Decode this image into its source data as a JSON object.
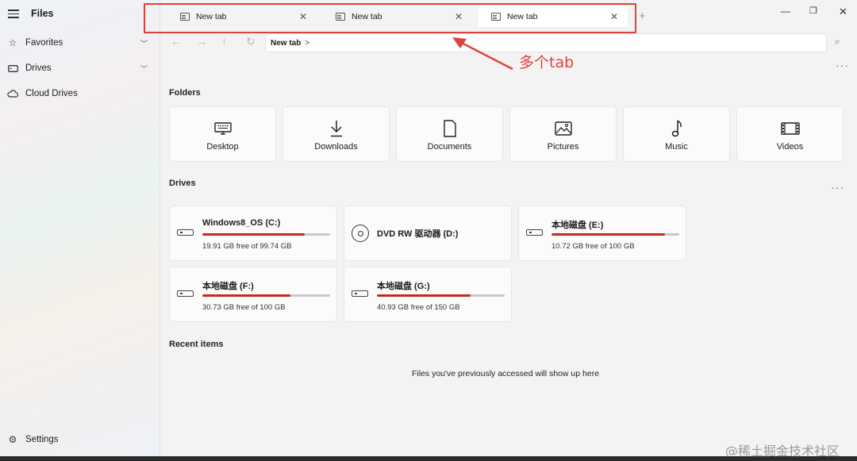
{
  "app": {
    "title": "Files"
  },
  "sidebar": {
    "items": [
      {
        "label": "Favorites",
        "icon": "star-icon"
      },
      {
        "label": "Drives",
        "icon": "drive-icon"
      },
      {
        "label": "Cloud Drives",
        "icon": "cloud-icon"
      }
    ],
    "settings_label": "Settings"
  },
  "tabs": [
    {
      "label": "New tab",
      "active": false
    },
    {
      "label": "New tab",
      "active": false
    },
    {
      "label": "New tab",
      "active": true
    }
  ],
  "address": {
    "crumb": "New tab",
    "separator": ">"
  },
  "annotation": {
    "label": "多个tab",
    "color": "#e0423b"
  },
  "folders": {
    "heading": "Folders",
    "items": [
      {
        "label": "Desktop",
        "icon": "desktop-icon"
      },
      {
        "label": "Downloads",
        "icon": "download-icon"
      },
      {
        "label": "Documents",
        "icon": "document-icon"
      },
      {
        "label": "Pictures",
        "icon": "picture-icon"
      },
      {
        "label": "Music",
        "icon": "music-icon"
      },
      {
        "label": "Videos",
        "icon": "video-icon"
      }
    ]
  },
  "drives": {
    "heading": "Drives",
    "items": [
      {
        "name": "Windows8_OS (C:)",
        "free": "19.91 GB free of 99.74 GB",
        "used_fraction": 0.8,
        "type": "disk"
      },
      {
        "name": "DVD RW 驱动器 (D:)",
        "type": "dvd"
      },
      {
        "name": "本地磁盘 (E:)",
        "free": "10.72 GB free of 100 GB",
        "used_fraction": 0.89,
        "type": "disk"
      },
      {
        "name": "本地磁盘 (F:)",
        "free": "30.73 GB free of 100 GB",
        "used_fraction": 0.69,
        "type": "disk"
      },
      {
        "name": "本地磁盘 (G:)",
        "free": "40.93 GB free of 150 GB",
        "used_fraction": 0.73,
        "type": "disk"
      }
    ]
  },
  "recent": {
    "heading": "Recent items",
    "empty_message": "Files you've previously accessed will show up here"
  },
  "watermark": "@稀土掘金技术社区",
  "colors": {
    "accent_bar": "#c42b1c",
    "highlight": "#e0423b"
  }
}
